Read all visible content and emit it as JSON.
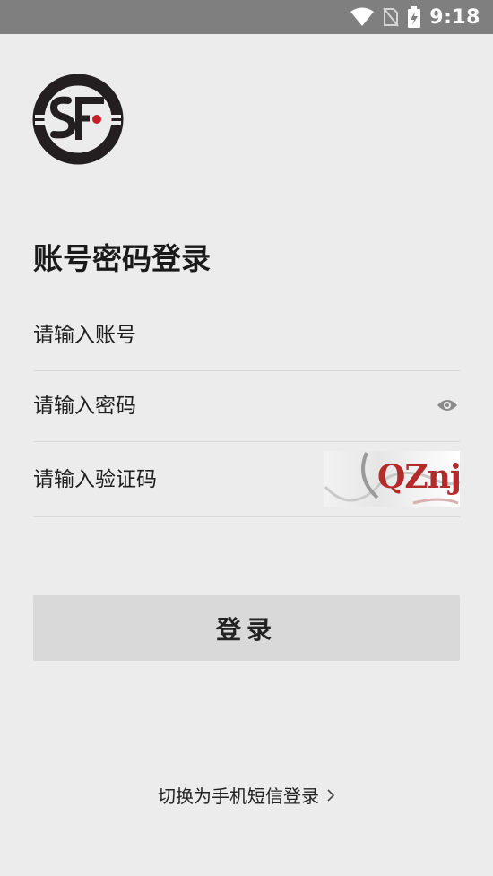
{
  "status_bar": {
    "time": "9:18"
  },
  "page": {
    "title": "账号密码登录"
  },
  "form": {
    "account_placeholder": "请输入账号",
    "password_placeholder": "请输入密码",
    "captcha_placeholder": "请输入验证码",
    "captcha_text": "QZnj"
  },
  "login_button": {
    "label": "登录"
  },
  "switch_link": {
    "label": "切换为手机短信登录"
  },
  "colors": {
    "brand": "#231f20",
    "brand_dot": "#c81d25",
    "captcha_text": "#b52a2a"
  },
  "icons": [
    "wifi-icon",
    "no-sim-icon",
    "battery-charging-icon",
    "sf-logo",
    "eye-icon",
    "chevron-right-icon"
  ]
}
